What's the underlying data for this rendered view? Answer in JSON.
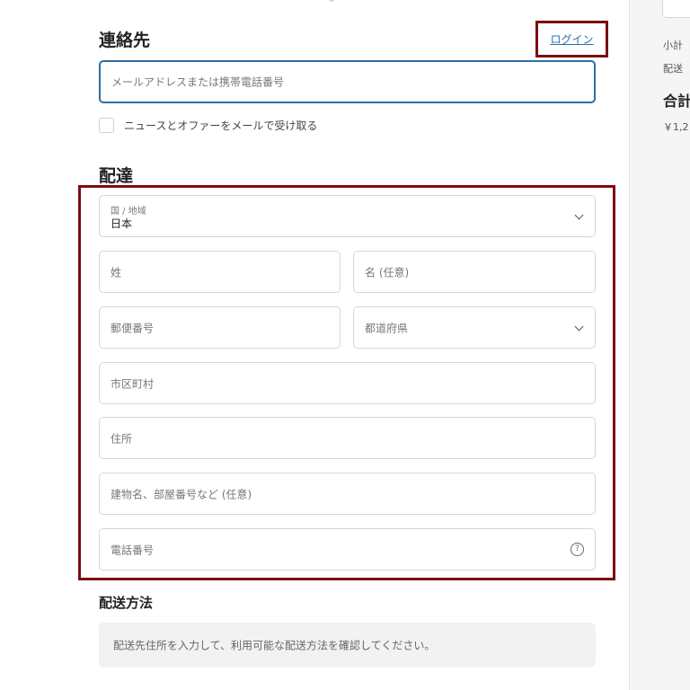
{
  "contact": {
    "title": "連絡先",
    "login_label": "ログイン",
    "email_placeholder": "メールアドレスまたは携帯電話番号",
    "newsletter_label": "ニュースとオファーをメールで受け取る"
  },
  "delivery": {
    "title": "配達",
    "country_label": "国 / 地域",
    "country_value": "日本",
    "last_name_placeholder": "姓",
    "first_name_placeholder": "名 (任意)",
    "postal_placeholder": "郵便番号",
    "prefecture_placeholder": "都道府県",
    "city_placeholder": "市区町村",
    "address_placeholder": "住所",
    "building_placeholder": "建物名、部屋番号など (任意)",
    "phone_placeholder": "電話番号",
    "help_glyph": "?"
  },
  "shipping": {
    "title": "配送方法",
    "notice": "配送先住所を入力して、利用可能な配送方法を確認してください。"
  },
  "summary": {
    "subtotal_label": "小計",
    "shipping_label": "配送",
    "total_label": "合計",
    "total_value": "￥1,2"
  },
  "colors": {
    "highlight": "#7a0d12",
    "focus": "#2c6fa6",
    "link": "#2b6cb0"
  }
}
